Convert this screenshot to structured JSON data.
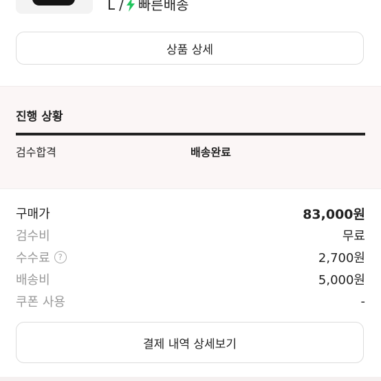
{
  "product": {
    "option_size": "L",
    "option_separator": "/",
    "shipping_badge": "빠른배송",
    "detail_button": "상품 상세"
  },
  "progress": {
    "title": "진행 상황",
    "steps": [
      "검수합격",
      "배송완료"
    ]
  },
  "prices": [
    {
      "label": "구매가",
      "value": "83,000원"
    },
    {
      "label": "검수비",
      "value": "무료"
    },
    {
      "label": "수수료",
      "help": "?",
      "value": "2,700원"
    },
    {
      "label": "배송비",
      "value": "5,000원"
    },
    {
      "label": "쿠폰 사용",
      "value": "-"
    }
  ],
  "payment_button": "결제 내역 상세보기",
  "colors": {
    "bolt": "#22c55e",
    "progress_bg": "#fbf6f6",
    "text": "#222222",
    "muted": "#999999"
  }
}
